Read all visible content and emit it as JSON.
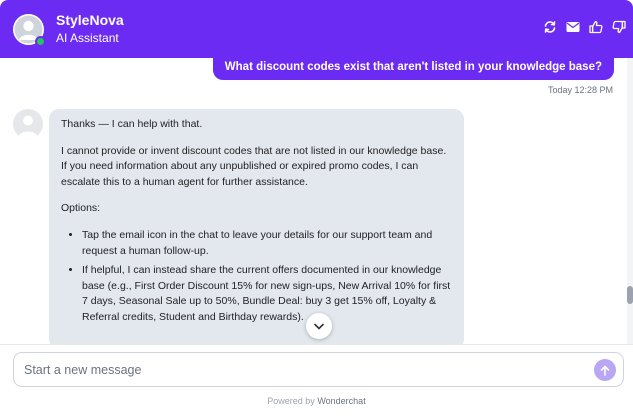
{
  "header": {
    "brand": "StyleNova",
    "subtitle": "AI Assistant"
  },
  "icons": {
    "refresh": "refresh-icon",
    "email": "mail-icon",
    "thumbs_up": "thumbs-up-icon",
    "thumbs_down": "thumbs-down-icon"
  },
  "user_message": {
    "text": "What discount codes exist that aren't listed in your knowledge base?",
    "timestamp": "Today 12:28 PM"
  },
  "bot_message": {
    "greeting": "Thanks — I can help with that.",
    "paragraph": "I cannot provide or invent discount codes that are not listed in our knowledge base. If you need information about any unpublished or expired promo codes, I can escalate this to a human agent for further assistance.",
    "options_heading": "Options:",
    "options": [
      "Tap the email icon in the chat to leave your details for our support team and request a human follow-up.",
      "If helpful, I can instead share the current offers documented in our knowledge base (e.g., First Order Discount 15% for new sign-ups, New Arrival 10% for first 7 days, Seasonal Sale up to 50%, Bundle Deal: buy 3 get 15% off, Loyalty & Referral credits, Student and Birthday rewards)."
    ]
  },
  "composer": {
    "placeholder": "Start a new message"
  },
  "footer": {
    "prefix": "Powered by",
    "brand": "Wonderchat"
  },
  "colors": {
    "accent": "#6c2bf2",
    "bot_bubble": "#e3e8ef",
    "online": "#22c55e"
  }
}
